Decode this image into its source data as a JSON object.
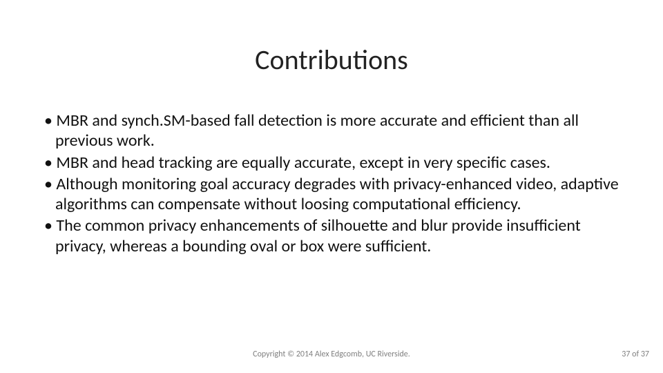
{
  "title": "Contributions",
  "bullets": [
    "MBR and synch.SM-based fall detection is more accurate and efficient than all previous work.",
    "MBR and head tracking are equally accurate, except in very specific cases.",
    "Although monitoring goal accuracy degrades with privacy-enhanced video, adaptive algorithms can compensate without loosing computational efficiency.",
    "The common privacy enhancements of silhouette and blur provide insufficient privacy, whereas a bounding oval or box were sufficient."
  ],
  "footer": {
    "copyright": "Copyright © 2014 Alex Edgcomb, UC Riverside.",
    "page": "37 of 37"
  }
}
